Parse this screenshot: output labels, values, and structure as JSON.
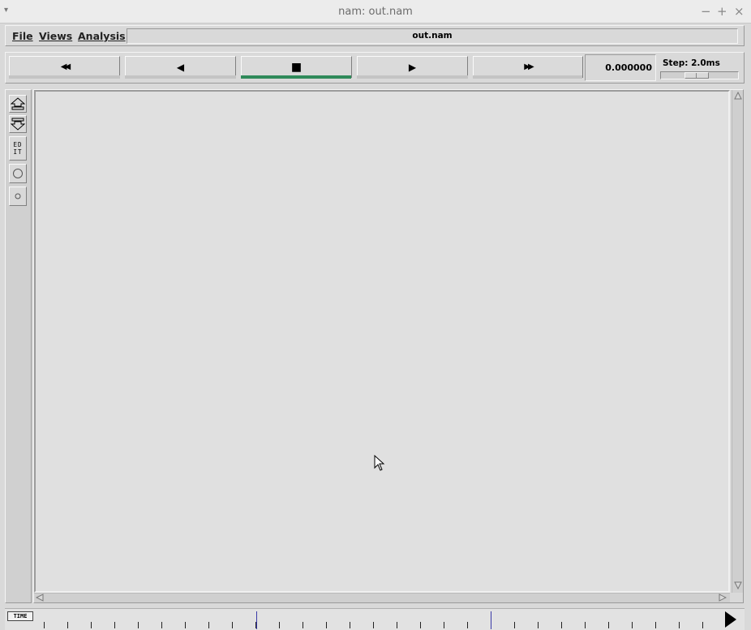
{
  "window": {
    "title": "nam: out.nam",
    "menu_arrow_icon": "triangle-down-icon",
    "minimize": "−",
    "maximize": "+",
    "close": "×"
  },
  "menubar": {
    "file": "File",
    "views": "Views",
    "analysis": "Analysis",
    "filename": "out.nam"
  },
  "controls": {
    "rewind": "◀◀",
    "back": "◀",
    "stop": "■",
    "play": "▶",
    "fast_forward": "▶▶",
    "active": "stop",
    "time": "0.000000",
    "step_label": "Step: 2.0ms",
    "step_slider_value": 0.45
  },
  "tools": {
    "edit_label_line1": "ED",
    "edit_label_line2": "IT"
  },
  "timeline": {
    "label": "TIME"
  }
}
